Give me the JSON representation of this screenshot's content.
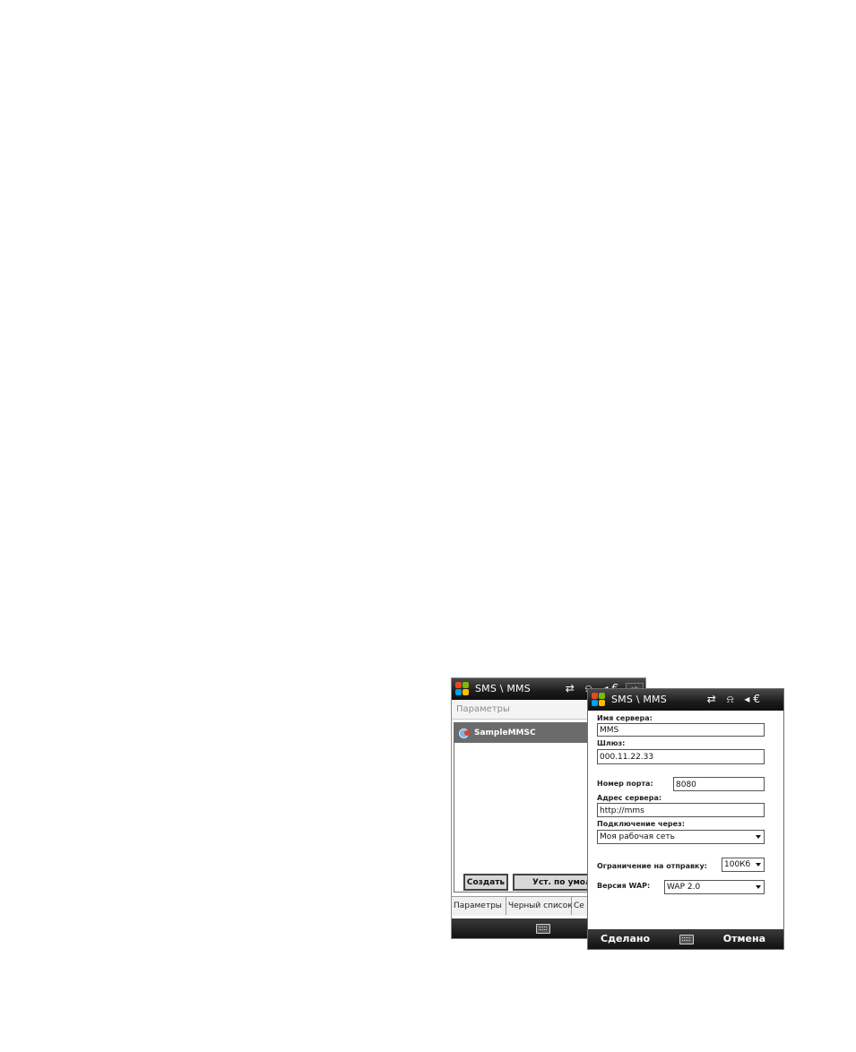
{
  "back_screen": {
    "title": "SMS \\ MMS",
    "status_icons": "⇄ ⍾ ◂€",
    "ok_label": "ok",
    "heading": "Параметры",
    "list_items": [
      {
        "label": "SampleMMSC"
      }
    ],
    "buttons": {
      "create": "Создать",
      "set_default": "Уст. по умолч"
    },
    "tabs": [
      {
        "label": "Параметры"
      },
      {
        "label": "Черный список"
      },
      {
        "label": "Се"
      }
    ]
  },
  "front_screen": {
    "title": "SMS \\ MMS",
    "status_icons": "⇄ ⍾ ◂€",
    "fields": {
      "server_name": {
        "label": "Имя сервера:",
        "value": "MMS"
      },
      "gateway": {
        "label": "Шлюз:",
        "value": "000.11.22.33"
      },
      "port": {
        "label": "Номер порта:",
        "value": "8080"
      },
      "server_address": {
        "label": "Адрес сервера:",
        "value": "http://mms"
      },
      "connect_via": {
        "label": "Подключение через:",
        "value": "Моя рабочая сеть"
      },
      "send_limit": {
        "label": "Ограничение на отправку:",
        "value": "100Кб"
      },
      "wap_version": {
        "label": "Версия WAP:",
        "value": "WAP 2.0"
      }
    },
    "softkeys": {
      "left": "Сделано",
      "right": "Отмена"
    }
  },
  "colors": {
    "titlebar": "#1c1c1c",
    "selection": "#6b6b6b",
    "windows_logo": [
      "#e8491d",
      "#7cbb00",
      "#00a1f1",
      "#ffbb00"
    ]
  }
}
